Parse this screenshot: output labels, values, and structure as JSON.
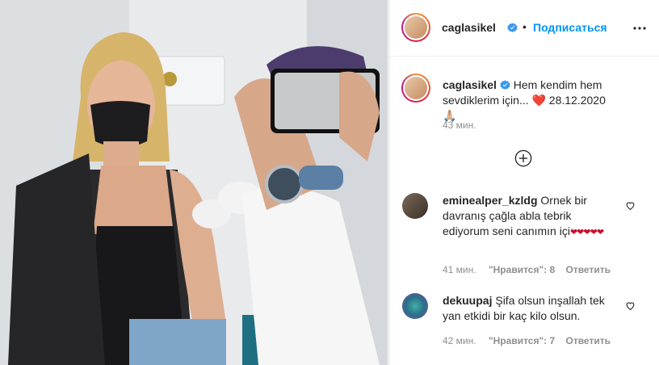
{
  "post": {
    "username": "caglasikel",
    "follow_label": "Подписаться",
    "dot": "•",
    "caption_text": "Hem kendim hem sevdiklerim için... ❤️ 28.12.2020 🙏🏼",
    "caption_time": "43 мин."
  },
  "comments": [
    {
      "username": "eminealper_kzldg",
      "text": "Ornek bir davranış çağla abla tebrik ediyorum seni canımın içi",
      "hearts": "❤❤❤❤❤",
      "time": "41 мин.",
      "likes": "\"Нравится\": 8",
      "reply": "Ответить"
    },
    {
      "username": "dekuupaj",
      "text": "Şifa olsun inşallah tek yan etkidi bir kaç kilo olsun.",
      "time": "42 мин.",
      "likes": "\"Нравится\": 7",
      "reply": "Ответить"
    }
  ],
  "colors": {
    "link": "#0095f6",
    "muted": "#8e8e8e",
    "verified": "#3897f0",
    "heart": "#c8102e"
  },
  "icons": [
    "verified-badge-icon",
    "more-options-icon",
    "load-more-plus-icon",
    "like-heart-icon"
  ]
}
